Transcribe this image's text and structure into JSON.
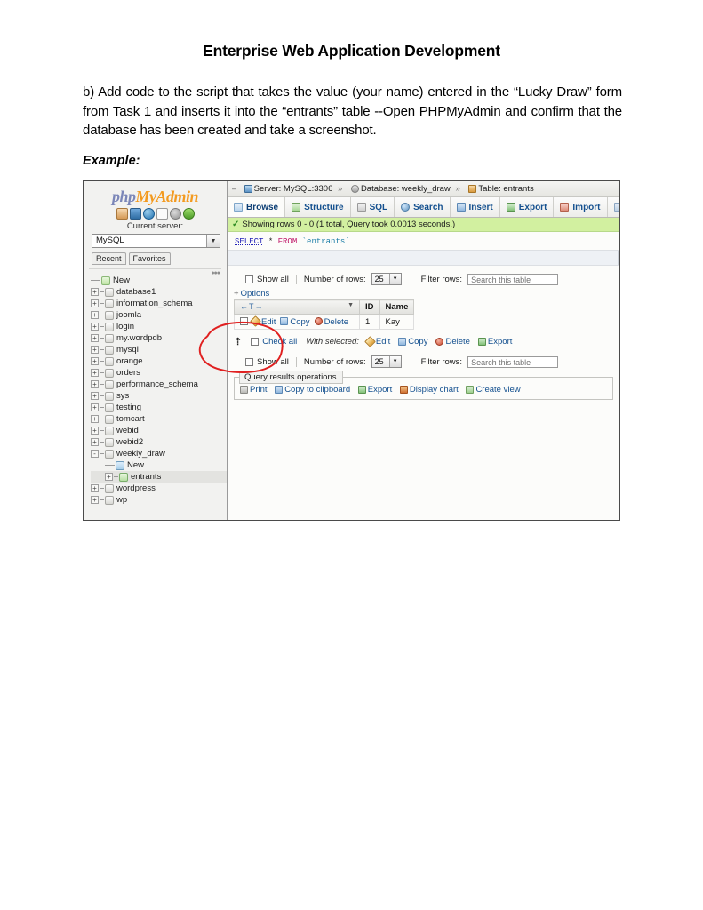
{
  "document": {
    "title": "Enterprise Web Application Development",
    "body": "b) Add code to the script that takes the value (your name) entered in the “Lucky Draw” form from Task 1 and inserts it into the “entrants” table --Open PHPMyAdmin and confirm that the database has been created and take a screenshot.",
    "example_label": "Example:"
  },
  "screenshot": {
    "sidebar": {
      "logo": {
        "php": "php",
        "my": "My",
        "admin": "Admin"
      },
      "icons": [
        "home-icon",
        "exit-icon",
        "globe-icon",
        "docs-icon",
        "gear-icon",
        "refresh-icon"
      ],
      "current_server_label": "Current server:",
      "server_select_value": "MySQL",
      "tabs": [
        "Recent",
        "Favorites"
      ],
      "tree": [
        {
          "label": "New",
          "type": "new",
          "indent": 0,
          "expander": "dash",
          "selected": false
        },
        {
          "label": "database1",
          "type": "db",
          "indent": 0,
          "expander": "+",
          "selected": false
        },
        {
          "label": "information_schema",
          "type": "db",
          "indent": 0,
          "expander": "+",
          "selected": false
        },
        {
          "label": "joomla",
          "type": "db",
          "indent": 0,
          "expander": "+",
          "selected": false
        },
        {
          "label": "login",
          "type": "db",
          "indent": 0,
          "expander": "+",
          "selected": false
        },
        {
          "label": "my.wordpdb",
          "type": "db",
          "indent": 0,
          "expander": "+",
          "selected": false
        },
        {
          "label": "mysql",
          "type": "db",
          "indent": 0,
          "expander": "+",
          "selected": false
        },
        {
          "label": "orange",
          "type": "db",
          "indent": 0,
          "expander": "+",
          "selected": false
        },
        {
          "label": "orders",
          "type": "db",
          "indent": 0,
          "expander": "+",
          "selected": false
        },
        {
          "label": "performance_schema",
          "type": "db",
          "indent": 0,
          "expander": "+",
          "selected": false
        },
        {
          "label": "sys",
          "type": "db",
          "indent": 0,
          "expander": "+",
          "selected": false
        },
        {
          "label": "testing",
          "type": "db",
          "indent": 0,
          "expander": "+",
          "selected": false
        },
        {
          "label": "tomcart",
          "type": "db",
          "indent": 0,
          "expander": "+",
          "selected": false
        },
        {
          "label": "webid",
          "type": "db",
          "indent": 0,
          "expander": "+",
          "selected": false
        },
        {
          "label": "webid2",
          "type": "db",
          "indent": 0,
          "expander": "+",
          "selected": false
        },
        {
          "label": "weekly_draw",
          "type": "db",
          "indent": 0,
          "expander": "-",
          "selected": false
        },
        {
          "label": "New",
          "type": "table-new",
          "indent": 1,
          "expander": "dash",
          "selected": false
        },
        {
          "label": "entrants",
          "type": "table-sel",
          "indent": 1,
          "expander": "+",
          "selected": true
        },
        {
          "label": "wordpress",
          "type": "db",
          "indent": 0,
          "expander": "+",
          "selected": false
        },
        {
          "label": "wp",
          "type": "db",
          "indent": 0,
          "expander": "+",
          "selected": false
        }
      ]
    },
    "breadcrumb": {
      "server_label": "Server: MySQL:3306",
      "database_label": "Database: weekly_draw",
      "table_label": "Table: entrants",
      "separator": "»"
    },
    "tabs": [
      {
        "label": "Browse",
        "icon": "browse-icon",
        "active": true
      },
      {
        "label": "Structure",
        "icon": "structure-icon",
        "active": false
      },
      {
        "label": "SQL",
        "icon": "sql-icon",
        "active": false
      },
      {
        "label": "Search",
        "icon": "search-icon",
        "active": false
      },
      {
        "label": "Insert",
        "icon": "insert-icon",
        "active": false
      },
      {
        "label": "Export",
        "icon": "export-icon",
        "active": false
      },
      {
        "label": "Import",
        "icon": "import-icon",
        "active": false
      }
    ],
    "status": "Showing rows 0 - 0 (1 total, Query took 0.0013 seconds.)",
    "sql": {
      "select": "SELECT",
      "star": "*",
      "from": "FROM",
      "table": "`entrants`"
    },
    "rows_toolbar": {
      "show_all": "Show all",
      "number_of_rows_label": "Number of rows:",
      "number_of_rows_value": "25",
      "filter_label": "Filter rows:",
      "filter_placeholder": "Search this table"
    },
    "options_label": "Options",
    "results": {
      "sort_arrows": "←T→",
      "columns": [
        "ID",
        "Name"
      ],
      "row_actions": [
        "Edit",
        "Copy",
        "Delete"
      ],
      "rows": [
        {
          "id": "1",
          "name": "Kay"
        }
      ]
    },
    "with_selected": {
      "check_all": "Check all",
      "label": "With selected:",
      "actions": [
        "Edit",
        "Copy",
        "Delete",
        "Export"
      ]
    },
    "query_results_operations": {
      "legend": "Query results operations",
      "links": [
        "Print",
        "Copy to clipboard",
        "Export",
        "Display chart",
        "Create view"
      ]
    },
    "annotation": {
      "color": "#e02020",
      "shape": "hand-drawn-ellipse"
    }
  }
}
